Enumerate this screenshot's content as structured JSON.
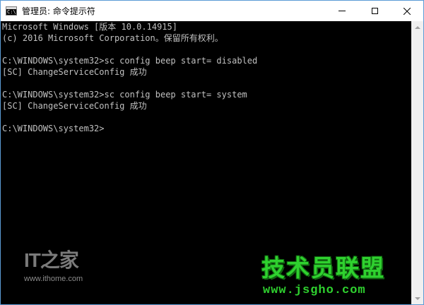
{
  "window": {
    "title": "管理员: 命令提示符",
    "icon": "cmd-icon",
    "controls": {
      "minimize": "minimize-icon",
      "maximize": "maximize-icon",
      "close": "close-icon"
    }
  },
  "console": {
    "lines": [
      "Microsoft Windows [版本 10.0.14915]",
      "(c) 2016 Microsoft Corporation。保留所有权利。",
      "",
      "C:\\WINDOWS\\system32>sc config beep start= disabled",
      "[SC] ChangeServiceConfig 成功",
      "",
      "C:\\WINDOWS\\system32>sc config beep start= system",
      "[SC] ChangeServiceConfig 成功",
      "",
      "C:\\WINDOWS\\system32>"
    ],
    "text_color": "#c0c0c0",
    "background": "#000000"
  },
  "watermarks": {
    "ithome_logo": "IT之家",
    "ithome_url": "www.ithome.com",
    "jsgho_title": "技术员联盟",
    "jsgho_url": "www.jsgho.com",
    "jsgho_color": "#2fd12f"
  }
}
